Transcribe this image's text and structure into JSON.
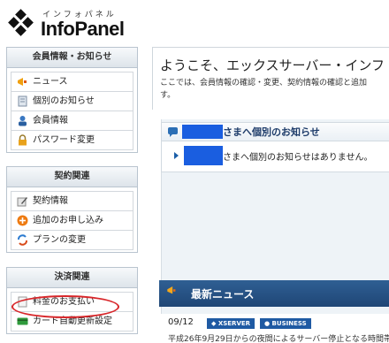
{
  "logo": {
    "subtitle": "インフォパネル",
    "name": "InfoPanel"
  },
  "sidebar": {
    "sections": [
      {
        "title": "会員情報・お知らせ",
        "items": [
          "ニュース",
          "個別のお知らせ",
          "会員情報",
          "パスワード変更"
        ]
      },
      {
        "title": "契約関連",
        "items": [
          "契約情報",
          "追加のお申し込み",
          "プランの変更"
        ]
      },
      {
        "title": "決済関連",
        "items": [
          "料金のお支払い",
          "カード自動更新設定"
        ]
      }
    ]
  },
  "main": {
    "welcome_title": "ようこそ、エックスサーバー・インフ",
    "welcome_desc": "ここでは、会員情報の確認・変更、契約情報の確認と追加",
    "welcome_desc2": "す。",
    "notice_head": "さまへ個別のお知らせ",
    "notice_body": "さまへ個別のお知らせはありません。",
    "news_title": "最新ニュース",
    "news_date": "09/12",
    "news_tags": [
      "XSERVER",
      "BUSINESS"
    ],
    "news_text": "平成26年9月29日からの夜間によるサーバー停止となる時間帯の"
  },
  "colors": {
    "redaction": "#1a5ee0",
    "news_bar": "#1f4676",
    "highlight_circle": "#d8262a"
  }
}
